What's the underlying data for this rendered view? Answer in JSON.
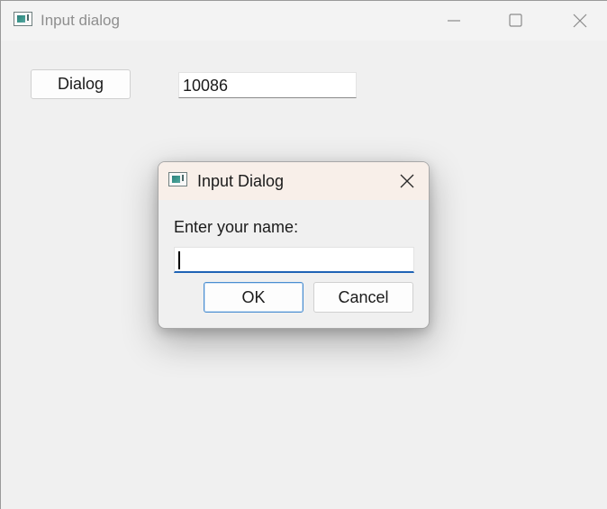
{
  "window": {
    "title": "Input dialog",
    "controls": {
      "minimize": "minimize-icon",
      "maximize": "maximize-icon",
      "close": "close-icon"
    }
  },
  "main": {
    "dialog_button_label": "Dialog",
    "result_value": "10086"
  },
  "dialog": {
    "title": "Input Dialog",
    "prompt": "Enter your name:",
    "input_value": "",
    "ok_label": "OK",
    "cancel_label": "Cancel"
  },
  "colors": {
    "accent": "#1f63b5",
    "dialog_titlebar": "#f8efe9",
    "window_background": "#f0f0f0"
  }
}
